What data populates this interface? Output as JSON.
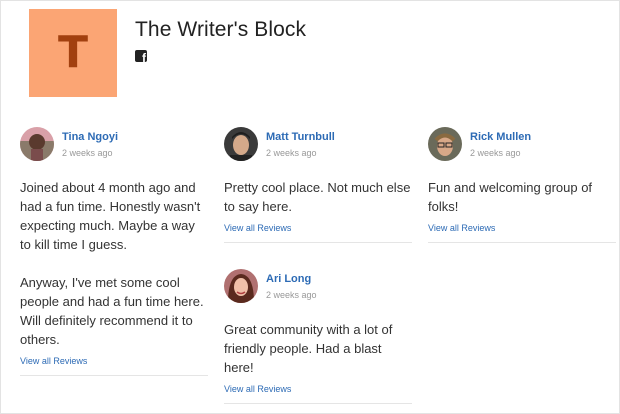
{
  "page": {
    "logo_letter": "T",
    "title": "The Writer's Block",
    "social_icon": "facebook-icon"
  },
  "colors": {
    "logo_bg": "#fba574",
    "logo_letter": "#a2400f",
    "link": "#2d6bb5",
    "time": "#999999",
    "separator": "#e5e5e5"
  },
  "reviews": [
    {
      "name": "Tina Ngoyi",
      "time": "2 weeks ago",
      "paragraphs": [
        "Joined about 4 month ago and had a fun time. Honestly wasn't expecting much. Maybe a way to kill time I guess.",
        "Anyway, I've met some cool people and had a fun time here. Will definitely recommend it to others."
      ],
      "link": "View all Reviews"
    },
    {
      "name": "Matt Turnbull",
      "time": "2 weeks ago",
      "paragraphs": [
        "Pretty cool place. Not much else to say here."
      ],
      "link": "View all Reviews"
    },
    {
      "name": "Ari Long",
      "time": "2 weeks ago",
      "paragraphs": [
        "Great community with a lot of friendly people. Had a blast here!"
      ],
      "link": "View all Reviews"
    },
    {
      "name": "Rick Mullen",
      "time": "2 weeks ago",
      "paragraphs": [
        "Fun and welcoming group of folks!"
      ],
      "link": "View all Reviews"
    }
  ]
}
